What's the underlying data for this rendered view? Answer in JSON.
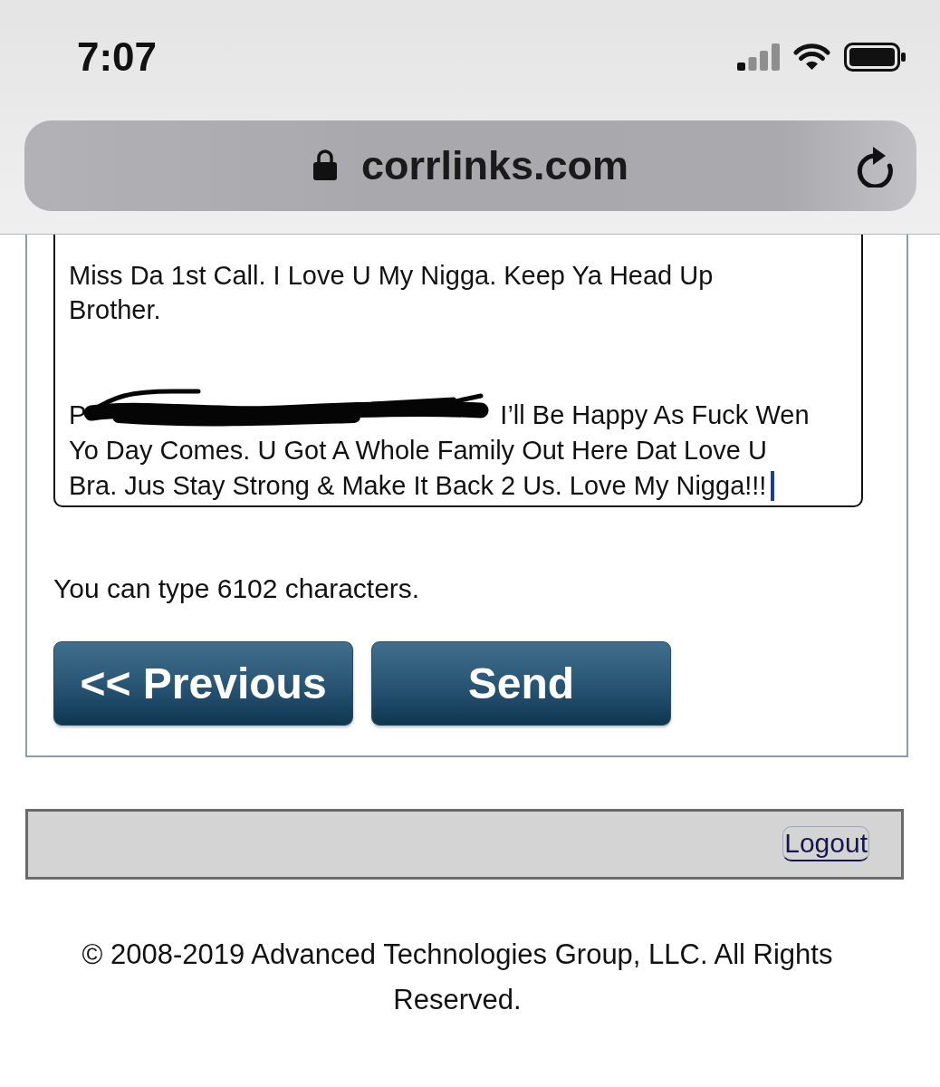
{
  "status_bar": {
    "time": "7:07"
  },
  "address_bar": {
    "url": "corrlinks.com",
    "secure": true
  },
  "message": {
    "focused": true,
    "paragraphs": [
      {
        "lines": [
          {
            "kind": "text",
            "text": "Miss Da 1st Call. I Love U My Nigga. Keep Ya Head Up"
          },
          {
            "kind": "text",
            "text": "Brother."
          }
        ]
      },
      {
        "lines": [
          {
            "kind": "redacted",
            "before": "P",
            "after": "I’ll Be Happy As Fuck Wen"
          },
          {
            "kind": "text",
            "text": "Yo Day Comes. U Got A Whole Family Out Here Dat Love U"
          },
          {
            "kind": "text",
            "text": "Bra. Jus Stay Strong & Make It Back 2 Us. Love My Nigga!!!"
          }
        ]
      }
    ]
  },
  "character_note": "You can type 6102 characters.",
  "buttons": [
    {
      "label": "<< Previous"
    },
    {
      "label": "Send"
    }
  ],
  "footer_bar": {
    "logout": {
      "label": "Logout",
      "focused": true
    }
  },
  "copyright": "© 2008-2019 Advanced Technologies Group, LLC. All Rights Reserved."
}
